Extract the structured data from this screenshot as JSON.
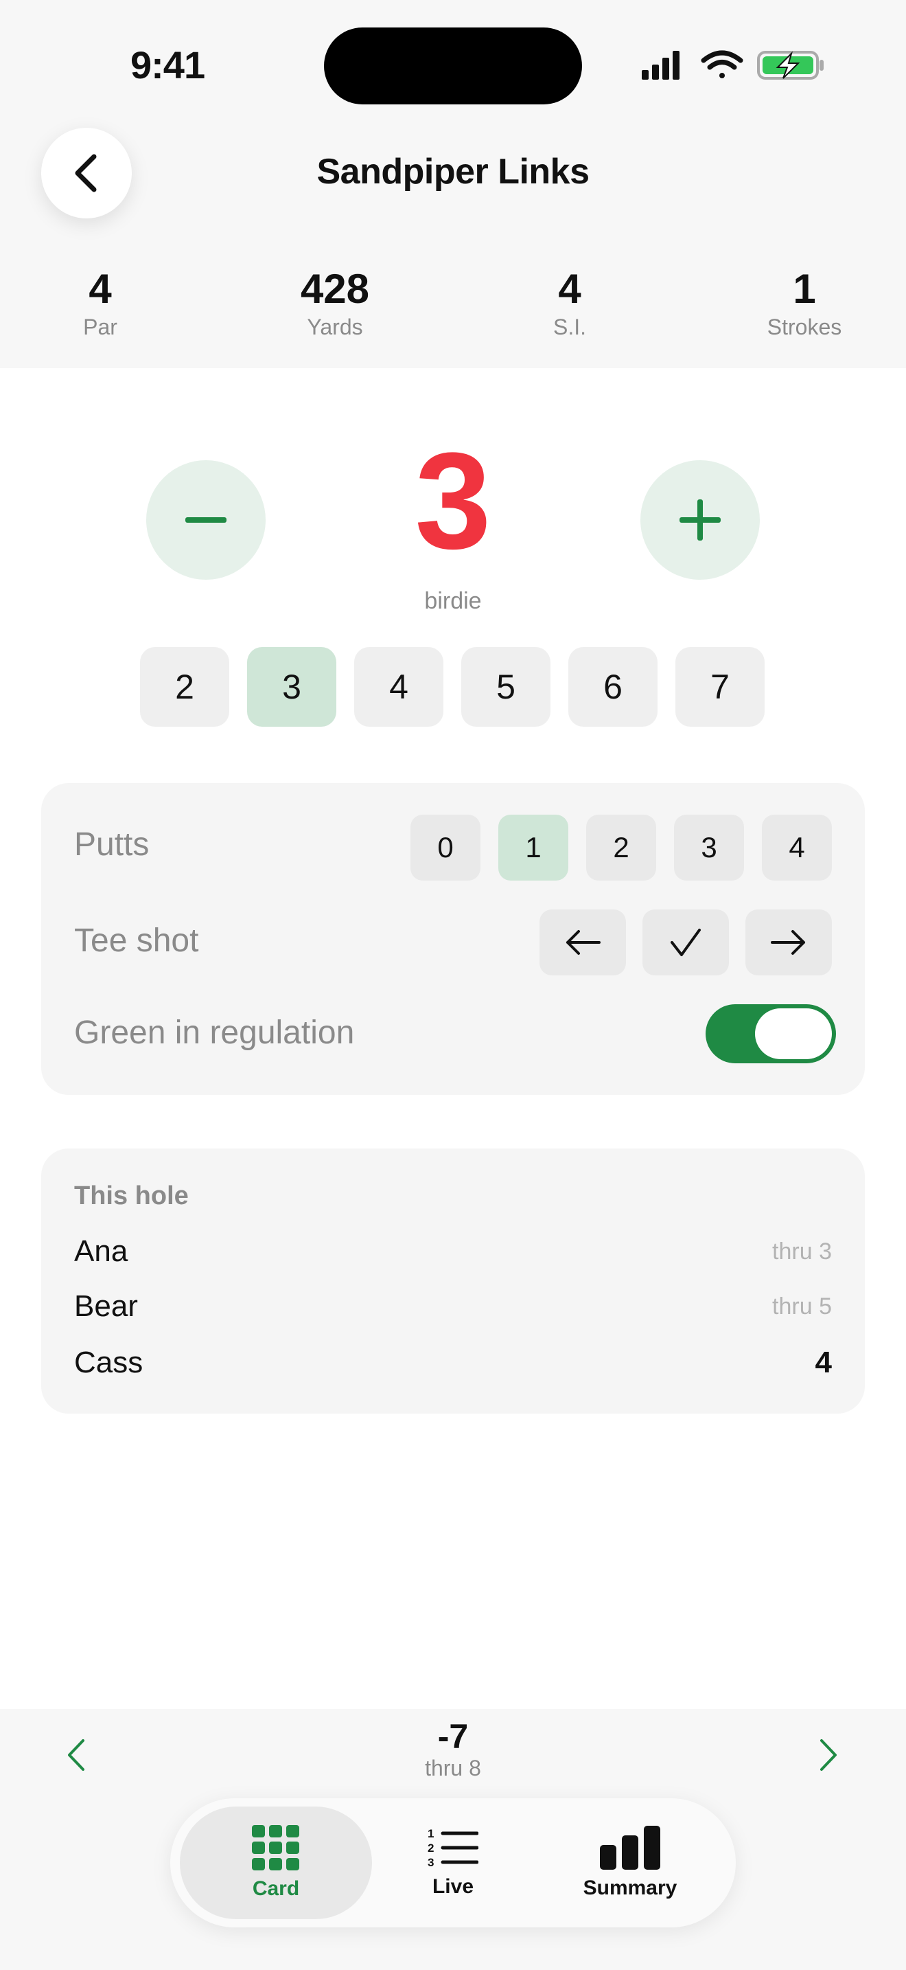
{
  "status_bar": {
    "time": "9:41"
  },
  "header": {
    "title": "Sandpiper Links"
  },
  "hole_stats": [
    {
      "value": "4",
      "label": "Par"
    },
    {
      "value": "428",
      "label": "Yards"
    },
    {
      "value": "4",
      "label": "S.I."
    },
    {
      "value": "1",
      "label": "Strokes"
    }
  ],
  "score": {
    "value": "3",
    "label": "birdie",
    "color": "#f0343f"
  },
  "quick_scores": [
    "2",
    "3",
    "4",
    "5",
    "6",
    "7"
  ],
  "quick_scores_selected": "3",
  "details": {
    "putts_label": "Putts",
    "putts_options": [
      "0",
      "1",
      "2",
      "3",
      "4"
    ],
    "putts_selected": "1",
    "tee_shot_label": "Tee shot",
    "tee_shot_options": [
      "arrow-left-icon",
      "checkmark-icon",
      "arrow-right-icon"
    ],
    "gir_label": "Green in regulation",
    "gir_on": true
  },
  "this_hole": {
    "heading": "This hole",
    "players": [
      {
        "name": "Ana",
        "value": "thru 3"
      },
      {
        "name": "Bear",
        "value": "thru 5"
      },
      {
        "name": "Cass",
        "value": "4"
      }
    ]
  },
  "footer": {
    "total": "-7",
    "thru": "thru 8"
  },
  "tabs": [
    {
      "label": "Card",
      "icon": "grid-icon",
      "active": true
    },
    {
      "label": "Live",
      "icon": "numbered-list-icon",
      "active": false
    },
    {
      "label": "Summary",
      "icon": "bar-chart-icon",
      "active": false
    }
  ],
  "colors": {
    "accent": "#1f8a44",
    "score": "#f0343f",
    "selected_chip": "#cfe6d7"
  }
}
